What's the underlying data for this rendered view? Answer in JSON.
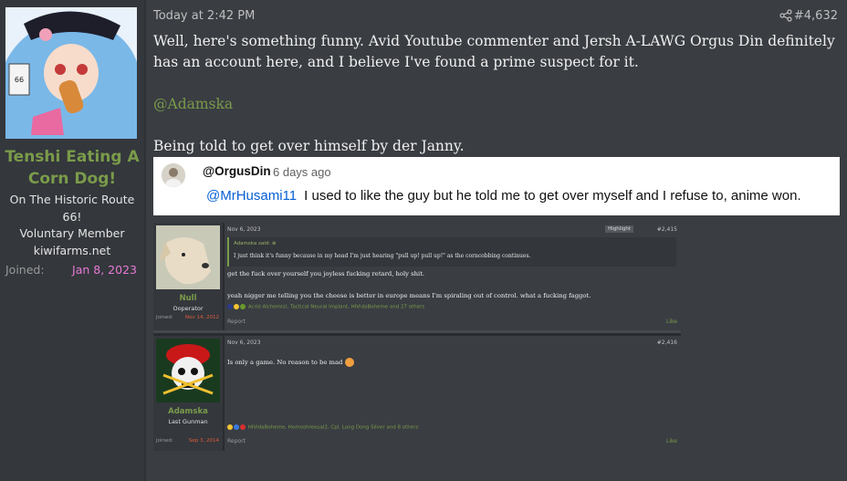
{
  "user": {
    "name": "Tenshi Eating A Corn Dog!",
    "title_lines": [
      "On The Historic Route",
      "66!",
      "Voluntary Member",
      "kiwifarms.net"
    ],
    "joined_label": "Joined:",
    "joined_value": "Jan 8, 2023"
  },
  "post": {
    "date": "Today at 2:42 PM",
    "number": "#4,632",
    "paragraph1": "Well, here's something funny. Avid Youtube commenter and Jersh A-LAWG Orgus Din definitely has an account here, and I believe I've found a prime suspect for it.",
    "mention": "@Adamska",
    "paragraph2": "Being told to get over himself by der Janny."
  },
  "youtube_comment": {
    "user": "@OrgusDin",
    "time": "6 days ago",
    "reply_to": "@MrHusami11",
    "text": "I used to like the guy but he told me to get over myself and I refuse to, anime won."
  },
  "embedded_thread": {
    "post1": {
      "user_name": "Null",
      "user_title": "Ooperator",
      "joined_label": "Joined:",
      "joined_value": "Nov 14, 2012",
      "date": "Nov 6, 2023",
      "highlight": "Highlight",
      "number": "#2,415",
      "quote_header": "Adamska said: ⊕",
      "quote_text": "I just think it's funny because in my head I'm just hearing \"pull up! pull up!\" as the corncobbing continues.",
      "line1": "get the fuck over yourself you joyless fucking retard, holy shit.",
      "line2": "yeah nigger me telling you the cheese is better in europe means I'm spiraling out of control. what a fucking faggot.",
      "reactions": "Acrid Alchemist, Tactical Neural Implant, HIVidaBoheme and 27 others",
      "report": "Report",
      "like": "Like"
    },
    "post2": {
      "user_name": "Adamska",
      "user_title": "Last Gunman",
      "joined_label": "Joined:",
      "joined_value": "Sep 3, 2014",
      "date": "Nov 6, 2023",
      "number": "#2,416",
      "line1": "Is only a game. No reason to be mad",
      "reactions": "HIVidaBoheme, Homoshrexual2, Cpl. Long Dong Silver and 8 others",
      "report": "Report",
      "like": "Like"
    }
  },
  "colors": {
    "accent_green": "#7a9b4a",
    "joined_pink": "#e879d6",
    "mention_blue": "#065fd4"
  }
}
